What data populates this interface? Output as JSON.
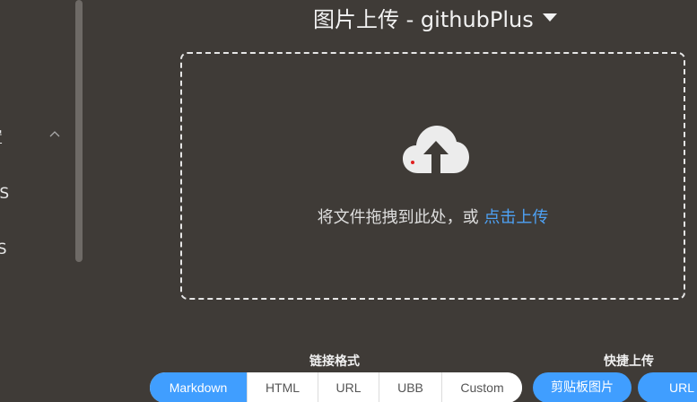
{
  "sidebar": {
    "items": [
      {
        "label": "置",
        "expanded": true
      },
      {
        "label": "OS"
      },
      {
        "label": "SS"
      }
    ]
  },
  "header": {
    "title": "图片上传 - githubPlus",
    "dropdown_icon": "caret-down-icon"
  },
  "dropzone": {
    "icon": "cloud-upload-icon",
    "text": "将文件拖拽到此处，或 ",
    "link_text": "点击上传"
  },
  "link_format": {
    "label": "链接格式",
    "options": [
      "Markdown",
      "HTML",
      "URL",
      "UBB",
      "Custom"
    ],
    "selected": "Markdown"
  },
  "quick_upload": {
    "label": "快捷上传",
    "clipboard_button": "剪贴板图片",
    "url_button": "URL"
  },
  "colors": {
    "background": "#3f3b37",
    "accent": "#409eff",
    "link": "#4ea2f5"
  }
}
